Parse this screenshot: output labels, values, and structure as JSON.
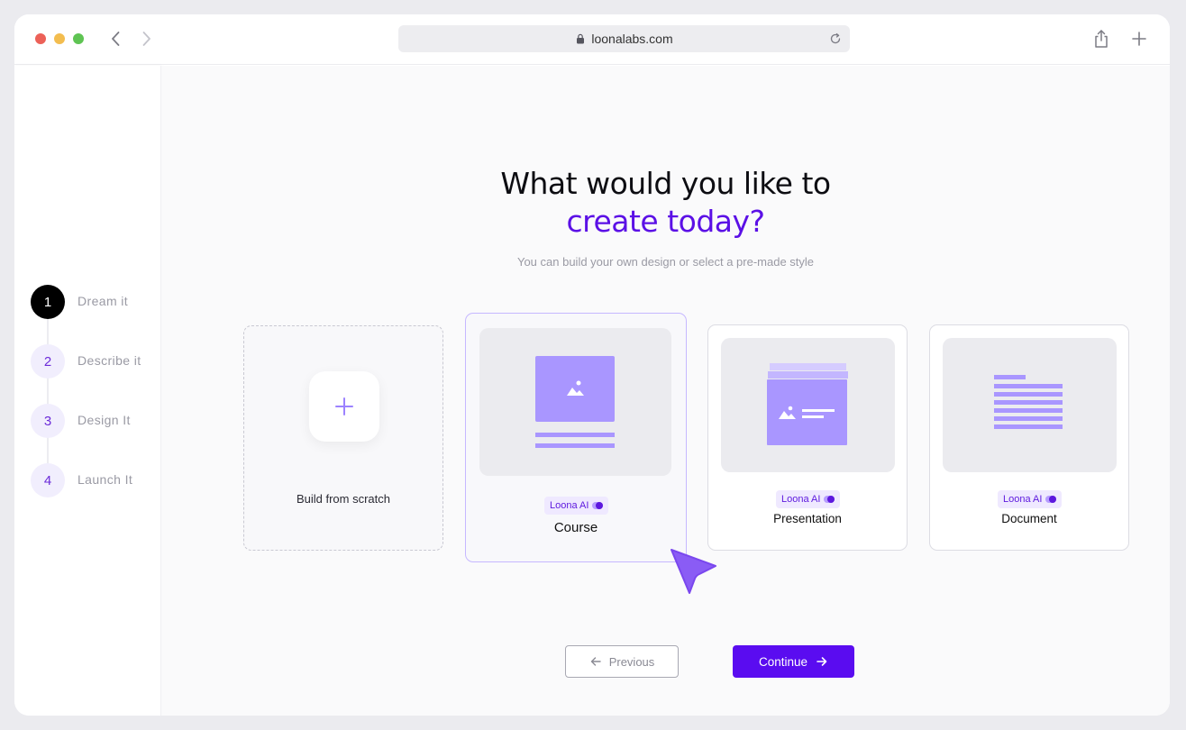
{
  "browser": {
    "url": "loonalabs.com",
    "icons": {
      "back": "chevron-left-icon",
      "forward": "chevron-right-icon",
      "lock": "lock-icon",
      "reload": "reload-icon",
      "share": "share-icon",
      "new_tab": "plus-icon"
    }
  },
  "steps": [
    {
      "number": "1",
      "label": "Dream it",
      "active": true
    },
    {
      "number": "2",
      "label": "Describe it",
      "active": false
    },
    {
      "number": "3",
      "label": "Design It",
      "active": false
    },
    {
      "number": "4",
      "label": "Launch It",
      "active": false
    }
  ],
  "heading": {
    "line1": "What would you like to",
    "line2": "create today?",
    "subtitle": "You can build your own design or select a pre-made style"
  },
  "cards": {
    "scratch": {
      "label": "Build from scratch"
    },
    "course": {
      "badge": "Loona AI",
      "label": "Course",
      "selected": true
    },
    "presentation": {
      "badge": "Loona AI",
      "label": "Presentation"
    },
    "document": {
      "badge": "Loona AI",
      "label": "Document"
    }
  },
  "buttons": {
    "previous": "Previous",
    "continue": "Continue"
  },
  "colors": {
    "accent": "#5a0cf0",
    "accent_light": "#a996ff",
    "heading_accent": "#5b10e6"
  }
}
